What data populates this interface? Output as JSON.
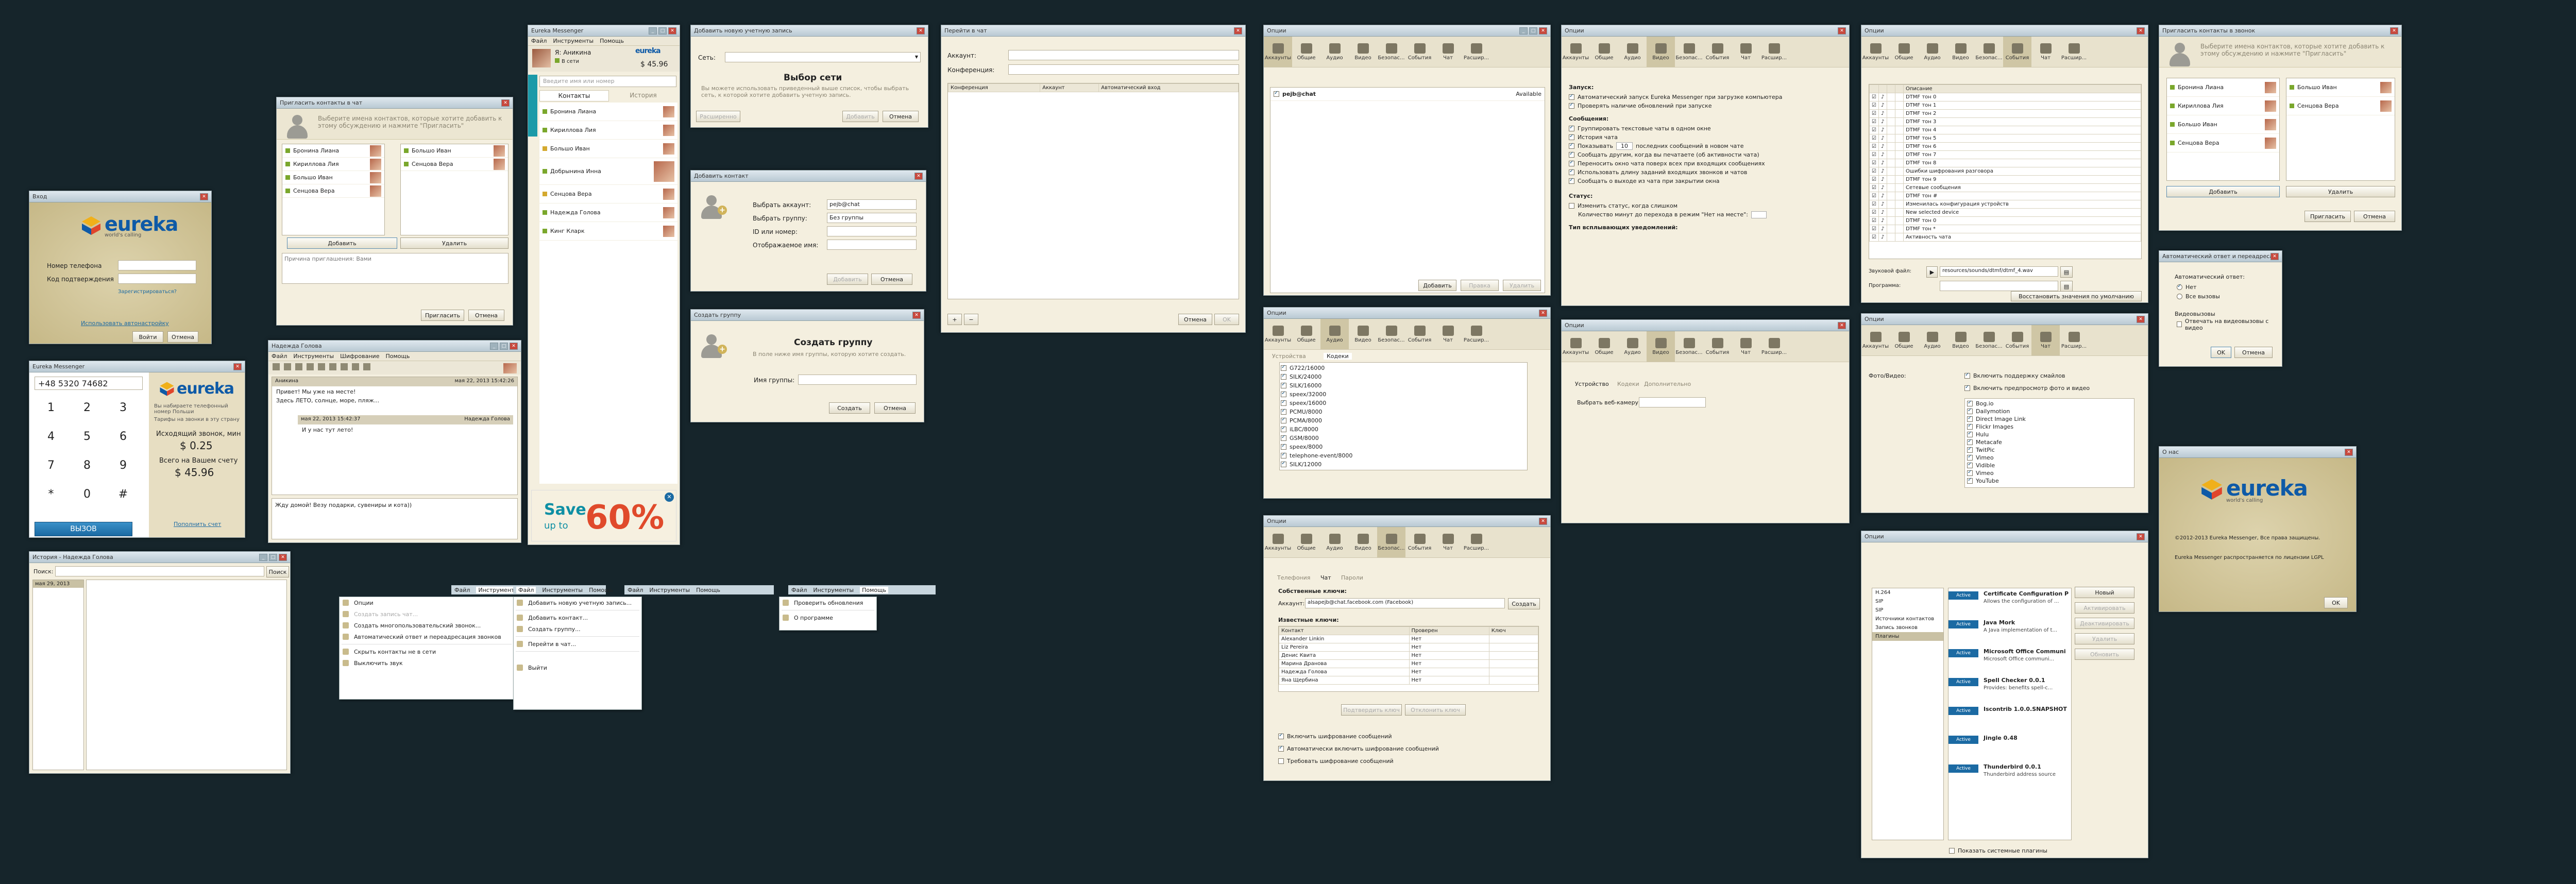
{
  "login": {
    "title": "Вход",
    "phone": "Номер телефона",
    "code": "Код подтверждения",
    "register": "Зарегистрироваться?",
    "auto": "Использовать автонастройку",
    "login_btn": "Войти",
    "cancel": "Отмена",
    "logo": "eureka",
    "tagline": "world's calling"
  },
  "dialer": {
    "title": "Eureka Messenger",
    "number": "+48 5320 74682",
    "keys": [
      "1",
      "2",
      "3",
      "4",
      "5",
      "6",
      "7",
      "8",
      "9",
      "*",
      "0",
      "#"
    ],
    "call": "ВЫЗОВ",
    "logo": "eureka",
    "promo": "Вы набираете телефонный номер Польши",
    "promo2": "Тарифы на звонки в эту страну",
    "rate_label": "Исходящий звонок, мин",
    "rate": "$ 0.25",
    "bal_label": "Всего на Вашем счету",
    "balance": "$ 45.96",
    "topup": "Пополнить счет"
  },
  "history": {
    "title": "История - Надежда Голова",
    "search": "Поиск:",
    "search_btn": "Поиск",
    "date": "мая 29, 2013"
  },
  "invite1": {
    "title": "Пригласить контакты в чат",
    "hint": "Выберите имена контактов, которые хотите добавить к этому обсуждению и нажмите \"Пригласить\"",
    "left": [
      "Бронина Лиана",
      "Кириллова Лия",
      "Большо Иван",
      "Сенцова Вера"
    ],
    "right": [
      "Большо Иван",
      "Сенцова Вера"
    ],
    "add": "Добавить",
    "remove": "Удалить",
    "reason": "Причина приглашения: Вами",
    "invite": "Пригласить",
    "cancel": "Отмена"
  },
  "chat": {
    "title": "Надежда Голова",
    "menu": [
      "Файл",
      "Инструменты",
      "Шифрование",
      "Помощь"
    ],
    "contact": "Аникина",
    "time1": "мая 22, 2013 15:42:26",
    "msg1": "Привет! Мы уже на месте!",
    "msg1b": "Здесь ЛЕТО, солнце, море, пляж...",
    "time2": "мая 22, 2013 15:42:37",
    "from2": "Надежда Голова",
    "msg2": "И у нас тут лето!",
    "msg3": "Жду домой! Везу подарки, сувениры и кота))"
  },
  "main": {
    "title": "Eureka Messenger",
    "menu": [
      "Файл",
      "Инструменты",
      "Помощь"
    ],
    "user": "Я: Аникина",
    "status": "В сети",
    "balance": "$ 45.96",
    "search": "Введите имя или номер",
    "tabs": [
      "Контакты",
      "История"
    ],
    "contacts": [
      "Бронина Лиана",
      "Кириллова Лия",
      "Большо Иван",
      "Добрынина Инна",
      "Сенцова Вера",
      "Надежда Голова",
      "Кинг Кларк"
    ],
    "ad_save": "Save",
    "ad_upto": "up to",
    "ad_pct": "60%"
  },
  "network": {
    "title": "Добавить новую учетную запись",
    "net": "Сеть:",
    "head": "Выбор сети",
    "desc": "Вы можете использовать приведенный выше список, чтобы выбрать сеть, к которой хотите добавить учетную запись.",
    "extend": "Расширенно",
    "add": "Добавить",
    "cancel": "Отмена"
  },
  "addcontact": {
    "title": "Добавить контакт",
    "acc": "Выбрать аккаунт:",
    "acc_val": "pejb@chat",
    "grp": "Выбрать группу:",
    "grp_val": "Без группы",
    "id": "ID или номер:",
    "name": "Отображаемое имя:",
    "add": "Добавить",
    "cancel": "Отмена"
  },
  "group": {
    "title": "Создать группу",
    "head": "Создать группу",
    "desc": "В поле ниже имя группы, которую хотите создать.",
    "name": "Имя группы:",
    "create": "Создать",
    "cancel": "Отмена"
  },
  "gochat": {
    "title": "Перейти в чат",
    "acc": "Аккаунт:",
    "conf": "Конференция:",
    "cols": [
      "Конференция",
      "Аккаунт",
      "Автоматический вход"
    ],
    "cancel": "Отмена",
    "ok": "OK"
  },
  "menus": {
    "tools": [
      "Опции",
      "Создать запись чат...",
      "Создать многопользовательский звонок...",
      "Автоматический ответ и переадресация звонков",
      "Скрыть контакты не в сети",
      "Выключить звук"
    ],
    "file": [
      "Добавить новую учетную запись...",
      "Добавить контакт...",
      "Создать группу...",
      "Перейти в чат...",
      "Выйти"
    ],
    "help": [
      "Проверить обновления",
      "О программе"
    ],
    "bar": [
      "Файл",
      "Инструменты",
      "Помощь"
    ]
  },
  "opt_tabs": [
    "Аккаунты",
    "Общие",
    "Аудио",
    "Видео",
    "Безопас...",
    "События",
    "Чат",
    "Расшир..."
  ],
  "opt_acc": {
    "title": "Опции",
    "acc": "pejb@chat",
    "state": "Available",
    "add": "Добавить",
    "edit": "Правка",
    "delete": "Удалить"
  },
  "opt_audio": {
    "title": "Опции",
    "tabs": [
      "Устройства",
      "Кодеки"
    ],
    "codecs": [
      "G722/16000",
      "SILK/24000",
      "SILK/16000",
      "speex/32000",
      "speex/16000",
      "PCMU/8000",
      "PCMA/8000",
      "iLBC/8000",
      "GSM/8000",
      "speex/8000",
      "telephone-event/8000",
      "SILK/12000",
      "SILK/8000"
    ]
  },
  "opt_sec": {
    "title": "Опции",
    "tabs": [
      "Телефония",
      "Чат",
      "Пароли"
    ],
    "acc": "Аккаунт:",
    "acc_val": "alsapejb@chat.facebook.com (Facebook)",
    "gen": "Создать",
    "own": "Собственные ключи:",
    "known": "Известные ключи:",
    "cols": [
      "Контакт",
      "Проверен",
      "Ключ"
    ],
    "rows": [
      [
        "Alexander Linkin",
        "Нет",
        ""
      ],
      [
        "Liz Pereira",
        "Нет",
        ""
      ],
      [
        "Денис Квита",
        "Нет",
        ""
      ],
      [
        "Марина Дранова",
        "Нет",
        ""
      ],
      [
        "Надежда Голова",
        "Нет",
        ""
      ],
      [
        "Яна Щербина",
        "Нет",
        ""
      ]
    ],
    "verify": "Подтвердить ключ",
    "forget": "Отклонить ключ",
    "c1": "Включить шифрование сообщений",
    "c2": "Автоматически включить шифрование сообщений",
    "c3": "Требовать шифрование сообщений"
  },
  "opt_general": {
    "title": "Опции",
    "startup": "Запуск:",
    "s1": "Автоматический запуск Eureka Messenger при загрузке компьютера",
    "s2": "Проверять наличие обновлений при запуске",
    "msgs": "Сообщения:",
    "m1": "Группировать текстовые чаты в одном окне",
    "m2": "История чата",
    "m3": "Показывать",
    "m3b": "последних сообщений в новом чате",
    "m4": "Сообщать другим, когда вы печатаете (об активности чата)",
    "m5": "Переносить окно чата поверх всех при входящих сообщениях",
    "m6": "Использовать длину заданий входящих звонков и чатов",
    "m7": "Сообщать о выходе из чата при закрытии окна",
    "status": "Статус:",
    "st1": "Изменить статус, когда слишком",
    "st2": "Количество минут до перехода в режим \"Нет на месте\":",
    "notif": "Тип всплывающих уведомлений:"
  },
  "opt_video": {
    "title": "Опции",
    "tabs": [
      "Устройство",
      "Кодеки",
      "Дополнительно"
    ],
    "cam": "Выбрать веб-камеру:"
  },
  "opt_events": {
    "title": "Опции",
    "cols": [
      "",
      "",
      "",
      "",
      "Описание"
    ],
    "events": [
      "DTMF тон 0",
      "DTMF тон 1",
      "DTMF тон 2",
      "DTMF тон 3",
      "DTMF тон 4",
      "DTMF тон 5",
      "DTMF тон 6",
      "DTMF тон 7",
      "DTMF тон 8",
      "Ошибки шифрования разговора",
      "DTMF тон 9",
      "Сетевые сообщения",
      "DTMF тон #",
      "Изменилась конфигурация устройств",
      "New selected device",
      "DTMF тон 0",
      "DTMF тон *",
      "Активность чата"
    ],
    "sound": "Звуковой файл:",
    "sound_val": "resources/sounds/dtmf/dtmf_4.wav",
    "prog": "Программа:",
    "restore": "Восстановить значения по умолчанию"
  },
  "opt_chat": {
    "title": "Опции",
    "photo": "Фото/Видео:",
    "c1": "Включить поддержку смайлов",
    "c2": "Включить предпросмотр фото и видео",
    "sites": [
      "Bog.io",
      "Dailymotion",
      "Direct Image Link",
      "Flickr Images",
      "Hulu",
      "Metacafe",
      "TwitPic",
      "Vimeo",
      "Vidible",
      "Vimeo",
      "YouTube"
    ]
  },
  "opt_adv": {
    "title": "Опции",
    "side": [
      "H.264",
      "SIP",
      "SIP",
      "Источники контактов",
      "Запись звонков",
      "Плагины"
    ],
    "plugins": [
      {
        "n": "Certificate Configuration P",
        "d": "Allows the configuration of ..."
      },
      {
        "n": "Java Mork",
        "d": "A Java implementation of t..."
      },
      {
        "n": "Microsoft Office Communi",
        "d": "Microsoft Office communi..."
      },
      {
        "n": "Spell Checker 0.0.1",
        "d": "Provides: benefits spell-c..."
      },
      {
        "n": "Iscontrib 1.0.0.SNAPSHOT",
        "d": ""
      },
      {
        "n": "Jingle 0.48",
        "d": ""
      },
      {
        "n": "Thunderbird 0.0.1",
        "d": "Thunderbird address source"
      }
    ],
    "badge": "Active",
    "btns": [
      "Новый",
      "Активировать",
      "Деактивировать",
      "Удалить",
      "Обновить"
    ],
    "sys": "Показать системные плагины"
  },
  "invite2": {
    "title": "Пригласить контакты в звонок",
    "hint": "Выберите имена контактов, которые хотите добавить к этому обсуждению и нажмите \"Пригласить\"",
    "left": [
      "Бронина Лиана",
      "Кириллова Лия",
      "Большо Иван",
      "Сенцова Вера"
    ],
    "right": [
      "Большо Иван",
      "Сенцова Вера"
    ],
    "add": "Добавить",
    "remove": "Удалить",
    "invite": "Пригласить",
    "cancel": "Отмена"
  },
  "autoans": {
    "title": "Автоматический ответ и переадресация",
    "h": "Автоматический ответ:",
    "o1": "Нет",
    "o2": "Все вызовы",
    "v": "Видеовызовы",
    "v1": "Отвечать на видеовызовы с видео",
    "ok": "OK",
    "cancel": "Отмена"
  },
  "about": {
    "title": "О нас",
    "logo": "eureka",
    "tagline": "world's calling",
    "copy": "©2012-2013 Eureka Messenger, Все права защищены.",
    "lic": "Eureka Messenger распространяется по лицензии LGPL",
    "ok": "OK"
  }
}
